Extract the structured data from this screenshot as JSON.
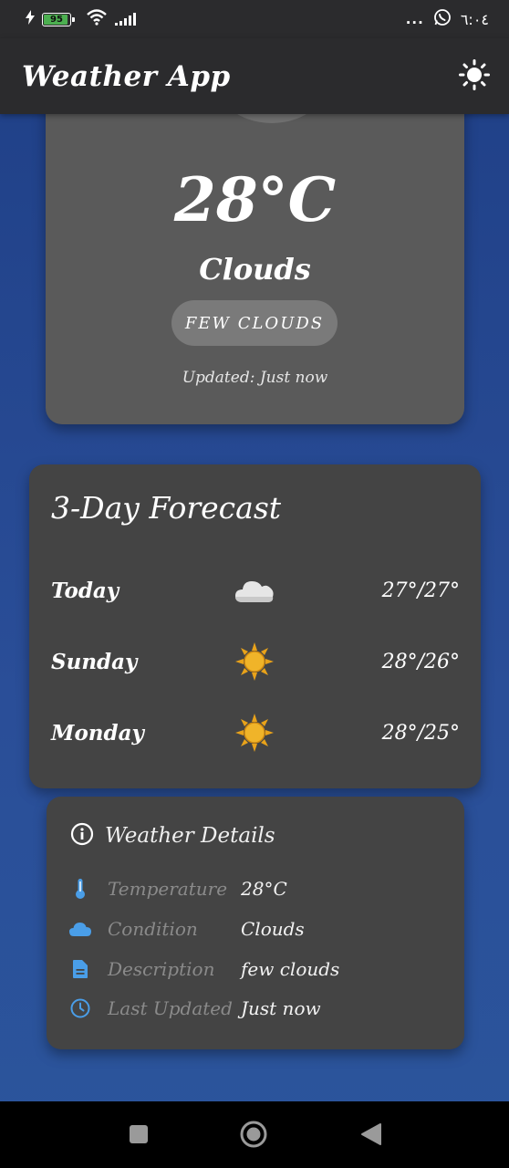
{
  "status_bar": {
    "battery": "95",
    "time": "٦:٠٤",
    "more": "..."
  },
  "app_bar": {
    "title": "Weather App",
    "theme_icon": "sun-icon"
  },
  "current": {
    "temperature": "28°C",
    "condition": "Clouds",
    "description": "FEW CLOUDS",
    "updated": "Updated: Just now"
  },
  "forecast": {
    "title": "3-Day Forecast",
    "days": [
      {
        "day": "Today",
        "icon": "cloud-icon",
        "temps": "27°/27°"
      },
      {
        "day": "Sunday",
        "icon": "sun-icon",
        "temps": "28°/26°"
      },
      {
        "day": "Monday",
        "icon": "sun-icon",
        "temps": "28°/25°"
      }
    ]
  },
  "details": {
    "title": "Weather Details",
    "rows": [
      {
        "label": "Temperature",
        "value": "28°C",
        "icon": "thermometer-icon"
      },
      {
        "label": "Condition",
        "value": "Clouds",
        "icon": "cloud-icon"
      },
      {
        "label": "Description",
        "value": "few clouds",
        "icon": "document-icon"
      },
      {
        "label": "Last Updated",
        "value": "Just now",
        "icon": "clock-icon"
      }
    ]
  },
  "colors": {
    "app_bar": "#2b2b2d",
    "background": "#24468f",
    "current_card": "#5a5a5a",
    "card": "#444444",
    "icon_blue": "#4a9ee8",
    "sun": "#e8a21a"
  }
}
